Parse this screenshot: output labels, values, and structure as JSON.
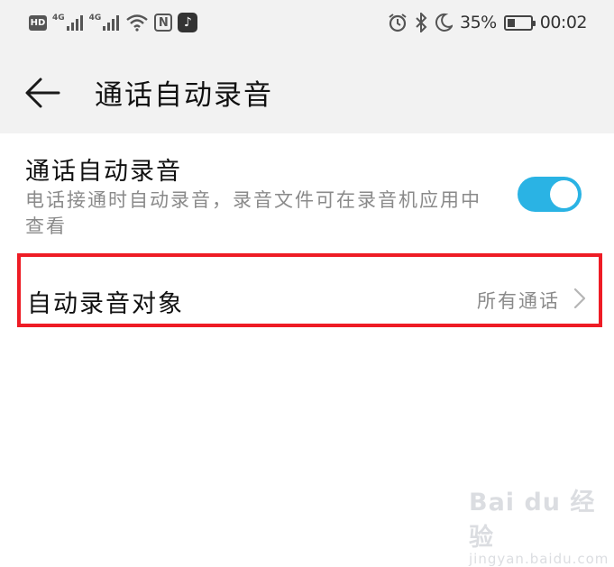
{
  "status_bar": {
    "hd_label": "HD",
    "network_1": "4G",
    "network_2": "4G",
    "nfc_label": "N",
    "app_icon": "tiktok-icon",
    "battery_percent_text": "35%",
    "battery_level": 0.35,
    "time": "00:02"
  },
  "header": {
    "title": "通话自动录音"
  },
  "settings": {
    "auto_record": {
      "title": "通话自动录音",
      "description": "电话接通时自动录音，录音文件可在录音机应用中查看",
      "enabled": true
    },
    "record_target": {
      "title": "自动录音对象",
      "value": "所有通话"
    }
  },
  "watermark": {
    "logo": "Bai du 经验",
    "url": "jingyan.baidu.com"
  },
  "colors": {
    "toggle_on": "#2ab3e4",
    "highlight_border": "#ee1c25",
    "header_bg": "#f2f2f2",
    "secondary_text": "#8a8a8a"
  }
}
